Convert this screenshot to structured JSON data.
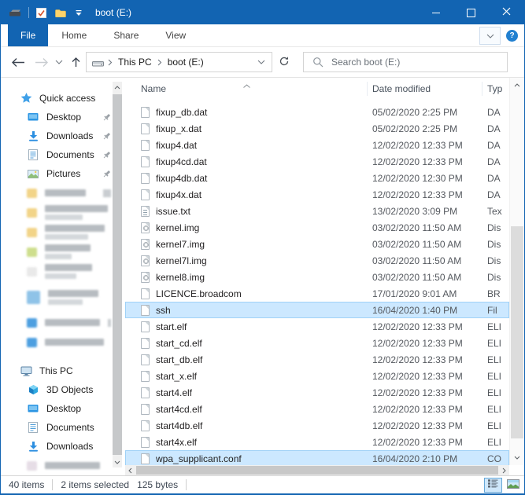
{
  "window": {
    "title": "boot (E:)",
    "accent_color": "#1264b2",
    "selection_color": "#cce8ff"
  },
  "titlebar": {
    "icons": [
      "drive-icon",
      "checkbox-icon",
      "folder-icon",
      "qat-dropdown-icon"
    ],
    "controls": {
      "minimize": "minimize",
      "maximize": "maximize",
      "close": "close"
    }
  },
  "ribbon": {
    "tabs": [
      {
        "label": "File",
        "active": true
      },
      {
        "label": "Home",
        "active": false
      },
      {
        "label": "Share",
        "active": false
      },
      {
        "label": "View",
        "active": false
      }
    ],
    "icons": [
      "expand-ribbon-icon",
      "help-icon"
    ],
    "help_glyph": "?"
  },
  "addressbar": {
    "nav_icons": [
      "back-icon",
      "forward-icon",
      "dropdown-icon",
      "up-icon",
      "refresh-icon"
    ],
    "breadcrumb": {
      "icon": "drive-icon",
      "segments": [
        {
          "label": "This PC"
        },
        {
          "label": "boot (E:)"
        }
      ]
    },
    "search": {
      "icon": "search-icon",
      "placeholder": "Search boot (E:)",
      "value": ""
    }
  },
  "sidebar": {
    "sections": [
      {
        "label": "Quick access",
        "icon": "star-icon",
        "items": [
          {
            "label": "Desktop",
            "icon": "desktop-icon",
            "pinned": true
          },
          {
            "label": "Downloads",
            "icon": "downloads-icon",
            "pinned": true
          },
          {
            "label": "Documents",
            "icon": "document-icon",
            "pinned": true
          },
          {
            "label": "Pictures",
            "icon": "pictures-icon",
            "pinned": true
          }
        ],
        "redacted_items": [
          {
            "icon_color": "#f2d488",
            "text_w": 52,
            "pin": true
          },
          {
            "icon_color": "#f2d488",
            "text_w": 80,
            "text2_w": 48
          },
          {
            "icon_color": "#f2d488",
            "text_w": 76,
            "text2_w": 55
          },
          {
            "icon_color": "#cede8d",
            "text_w": 58,
            "text2_w": 34
          },
          {
            "icon_color": "#e9e9e9",
            "text_w": 60,
            "text2_w": 40
          },
          {
            "icon_color": "#8fc3e8",
            "text_w": 64,
            "text2_w": 44,
            "tall": true
          },
          {
            "icon_color": "#4d9fe0",
            "text_w": 70,
            "pin": true
          },
          {
            "icon_color": "#4d9fe0",
            "text_w": 75,
            "pin": true
          }
        ]
      },
      {
        "label": "This PC",
        "icon": "this-pc-icon",
        "items": [
          {
            "label": "3D Objects",
            "icon": "cube-icon",
            "pinned": false
          },
          {
            "label": "Desktop",
            "icon": "desktop-icon",
            "pinned": false
          },
          {
            "label": "Documents",
            "icon": "document-icon",
            "pinned": false
          },
          {
            "label": "Downloads",
            "icon": "downloads-icon",
            "pinned": false
          }
        ],
        "redacted_items": [
          {
            "icon_color": "#e6dde6",
            "text_w": 70
          }
        ]
      }
    ]
  },
  "filelist": {
    "columns": {
      "name": "Name",
      "date": "Date modified",
      "type": "Typ"
    },
    "sort": {
      "column": "Name",
      "ascending": true
    },
    "rows": [
      {
        "name": "fixup_db.dat",
        "date": "05/02/2020 2:25 PM",
        "type": "DA",
        "icon": "file-blank-icon",
        "selected": false
      },
      {
        "name": "fixup_x.dat",
        "date": "05/02/2020 2:25 PM",
        "type": "DA",
        "icon": "file-blank-icon",
        "selected": false
      },
      {
        "name": "fixup4.dat",
        "date": "12/02/2020 12:33 PM",
        "type": "DA",
        "icon": "file-blank-icon",
        "selected": false
      },
      {
        "name": "fixup4cd.dat",
        "date": "12/02/2020 12:33 PM",
        "type": "DA",
        "icon": "file-blank-icon",
        "selected": false
      },
      {
        "name": "fixup4db.dat",
        "date": "12/02/2020 12:30 PM",
        "type": "DA",
        "icon": "file-blank-icon",
        "selected": false
      },
      {
        "name": "fixup4x.dat",
        "date": "12/02/2020 12:33 PM",
        "type": "DA",
        "icon": "file-blank-icon",
        "selected": false
      },
      {
        "name": "issue.txt",
        "date": "13/02/2020 3:09 PM",
        "type": "Tex",
        "icon": "file-text-icon",
        "selected": false
      },
      {
        "name": "kernel.img",
        "date": "03/02/2020 11:50 AM",
        "type": "Dis",
        "icon": "disc-image-icon",
        "selected": false
      },
      {
        "name": "kernel7.img",
        "date": "03/02/2020 11:50 AM",
        "type": "Dis",
        "icon": "disc-image-icon",
        "selected": false
      },
      {
        "name": "kernel7l.img",
        "date": "03/02/2020 11:50 AM",
        "type": "Dis",
        "icon": "disc-image-icon",
        "selected": false
      },
      {
        "name": "kernel8.img",
        "date": "03/02/2020 11:50 AM",
        "type": "Dis",
        "icon": "disc-image-icon",
        "selected": false
      },
      {
        "name": "LICENCE.broadcom",
        "date": "17/01/2020 9:01 AM",
        "type": "BR",
        "icon": "file-blank-icon",
        "selected": false
      },
      {
        "name": "ssh",
        "date": "16/04/2020 1:40 PM",
        "type": "Fil",
        "icon": "file-blank-icon",
        "selected": true
      },
      {
        "name": "start.elf",
        "date": "12/02/2020 12:33 PM",
        "type": "ELI",
        "icon": "file-blank-icon",
        "selected": false
      },
      {
        "name": "start_cd.elf",
        "date": "12/02/2020 12:33 PM",
        "type": "ELI",
        "icon": "file-blank-icon",
        "selected": false
      },
      {
        "name": "start_db.elf",
        "date": "12/02/2020 12:33 PM",
        "type": "ELI",
        "icon": "file-blank-icon",
        "selected": false
      },
      {
        "name": "start_x.elf",
        "date": "12/02/2020 12:33 PM",
        "type": "ELI",
        "icon": "file-blank-icon",
        "selected": false
      },
      {
        "name": "start4.elf",
        "date": "12/02/2020 12:33 PM",
        "type": "ELI",
        "icon": "file-blank-icon",
        "selected": false
      },
      {
        "name": "start4cd.elf",
        "date": "12/02/2020 12:33 PM",
        "type": "ELI",
        "icon": "file-blank-icon",
        "selected": false
      },
      {
        "name": "start4db.elf",
        "date": "12/02/2020 12:33 PM",
        "type": "ELI",
        "icon": "file-blank-icon",
        "selected": false
      },
      {
        "name": "start4x.elf",
        "date": "12/02/2020 12:33 PM",
        "type": "ELI",
        "icon": "file-blank-icon",
        "selected": false
      },
      {
        "name": "wpa_supplicant.conf",
        "date": "16/04/2020 2:10 PM",
        "type": "CO",
        "icon": "file-blank-icon",
        "selected": true
      }
    ]
  },
  "statusbar": {
    "items_count": "40 items",
    "selection": "2 items selected",
    "selection_size": "125 bytes",
    "view_buttons": [
      {
        "name": "details-view",
        "active": true
      },
      {
        "name": "thumbnail-view",
        "active": false
      }
    ]
  }
}
